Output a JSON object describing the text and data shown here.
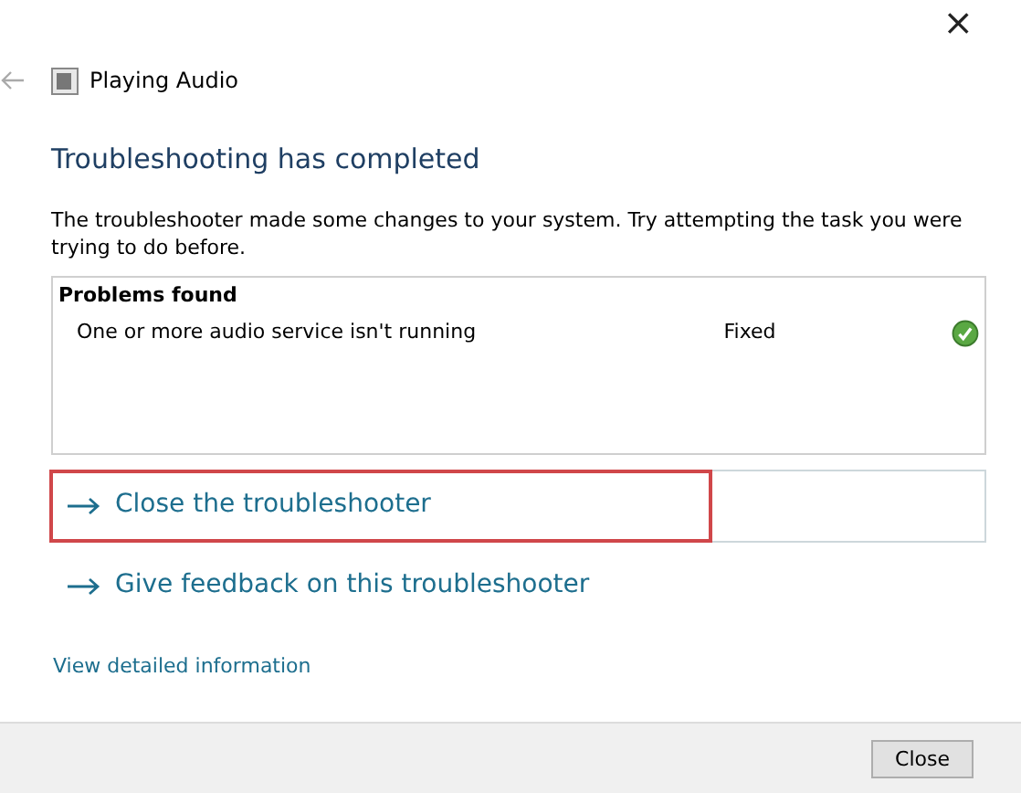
{
  "window": {
    "title": "Playing Audio",
    "close_glyph": "×"
  },
  "heading": "Troubleshooting has completed",
  "message": "The troubleshooter made some changes to your system. Try attempting the task you were trying to do before.",
  "problems": {
    "title": "Problems found",
    "items": [
      {
        "description": "One or more audio service isn't running",
        "status": "Fixed",
        "fixed": true
      }
    ]
  },
  "actions": [
    {
      "label": "Close the troubleshooter",
      "selected": true,
      "highlighted": true
    },
    {
      "label": "Give feedback on this troubleshooter",
      "selected": false,
      "highlighted": false
    }
  ],
  "details_link": "View detailed information",
  "buttons": [
    "Close"
  ]
}
